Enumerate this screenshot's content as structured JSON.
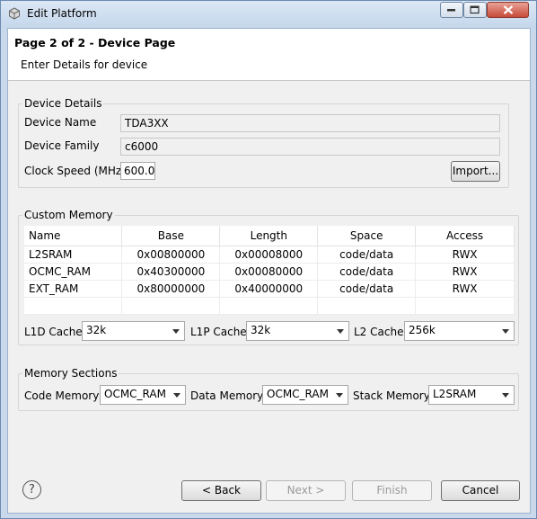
{
  "window": {
    "title": "Edit Platform"
  },
  "header": {
    "title": "Page 2 of 2 - Device Page",
    "subtitle": "Enter Details for device"
  },
  "device_details": {
    "legend": "Device Details",
    "device_name_label": "Device Name",
    "device_name_value": "TDA3XX",
    "device_family_label": "Device Family",
    "device_family_value": "c6000",
    "clock_speed_label": "Clock Speed (MHz)",
    "clock_speed_value": "600.0",
    "import_button": "Import..."
  },
  "custom_memory": {
    "legend": "Custom Memory",
    "columns": [
      "Name",
      "Base",
      "Length",
      "Space",
      "Access"
    ],
    "rows": [
      [
        "L2SRAM",
        "0x00800000",
        "0x00008000",
        "code/data",
        "RWX"
      ],
      [
        "OCMC_RAM",
        "0x40300000",
        "0x00080000",
        "code/data",
        "RWX"
      ],
      [
        "EXT_RAM",
        "0x80000000",
        "0x40000000",
        "code/data",
        "RWX"
      ]
    ],
    "l1d_label": "L1D Cache:",
    "l1d_value": "32k",
    "l1p_label": "L1P Cache:",
    "l1p_value": "32k",
    "l2_label": "L2 Cache:",
    "l2_value": "256k"
  },
  "memory_sections": {
    "legend": "Memory Sections",
    "code_label": "Code Memory:",
    "code_value": "OCMC_RAM",
    "data_label": "Data Memory:",
    "data_value": "OCMC_RAM",
    "stack_label": "Stack Memory:",
    "stack_value": "L2SRAM"
  },
  "footer": {
    "help_icon": "?",
    "back": "< Back",
    "next": "Next >",
    "finish": "Finish",
    "cancel": "Cancel"
  }
}
